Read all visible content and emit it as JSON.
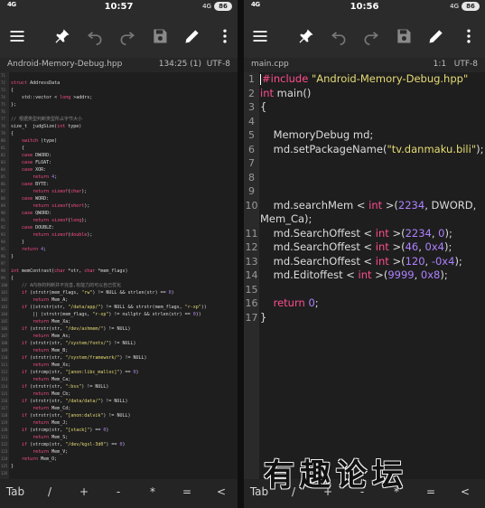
{
  "left": {
    "status": {
      "network": "4G",
      "time": "10:57",
      "battery": "86",
      "signal": "4G"
    },
    "file": {
      "name": "Android-Memory-Debug.hpp",
      "position": "134:25 (1)",
      "encoding": "UTF-8"
    },
    "lines": [
      {
        "n": "71",
        "html": ""
      },
      {
        "n": "72",
        "html": "<span class='kw'>struct</span> AddressData"
      },
      {
        "n": "73",
        "html": "{"
      },
      {
        "n": "74",
        "html": "    std::vector &lt; <span class='kw'>long</span> &gt;addrs;"
      },
      {
        "n": "75",
        "html": "};"
      },
      {
        "n": "76",
        "html": ""
      },
      {
        "n": "77",
        "html": "<span class='cm'>// 根据类型判断类型所占字节大小</span>"
      },
      {
        "n": "78",
        "html": "size_t  judgSize(<span class='kw'>int</span> type)"
      },
      {
        "n": "79",
        "html": "{"
      },
      {
        "n": "80",
        "html": "    <span class='kw'>switch</span> (type)"
      },
      {
        "n": "81",
        "html": "    {"
      },
      {
        "n": "82",
        "html": "    <span class='kw'>case</span> DWORD:"
      },
      {
        "n": "83",
        "html": "    <span class='kw'>case</span> FLOAT:"
      },
      {
        "n": "84",
        "html": "    <span class='kw'>case</span> XOR:"
      },
      {
        "n": "85",
        "html": "        <span class='kw'>return</span> <span class='num'>4</span>;"
      },
      {
        "n": "86",
        "html": "    <span class='kw'>case</span> BYTE:"
      },
      {
        "n": "87",
        "html": "        <span class='kw'>return</span> <span class='kw'>sizeof</span>(<span class='kw'>char</span>);"
      },
      {
        "n": "88",
        "html": "    <span class='kw'>case</span> WORD:"
      },
      {
        "n": "89",
        "html": "        <span class='kw'>return</span> <span class='kw'>sizeof</span>(<span class='kw'>short</span>);"
      },
      {
        "n": "90",
        "html": "    <span class='kw'>case</span> QWORD:"
      },
      {
        "n": "91",
        "html": "        <span class='kw'>return</span> <span class='kw'>sizeof</span>(<span class='kw'>long</span>);"
      },
      {
        "n": "92",
        "html": "    <span class='kw'>case</span> DOUBLE:"
      },
      {
        "n": "93",
        "html": "        <span class='kw'>return</span> <span class='kw'>sizeof</span>(<span class='kw'>double</span>);"
      },
      {
        "n": "94",
        "html": "    }"
      },
      {
        "n": "95",
        "html": "    <span class='kw'>return</span> <span class='num'>4</span>;"
      },
      {
        "n": "96",
        "html": "}"
      },
      {
        "n": "97",
        "html": ""
      },
      {
        "n": "98",
        "html": "<span class='kw'>int</span> memContrast(<span class='kw'>char</span> *str, <span class='kw'>char</span> *mem_flags)"
      },
      {
        "n": "99",
        "html": "{"
      },
      {
        "n": "100",
        "html": "    <span class='cm'>// A内存的判断并不完善,有能力的可以自己优化</span>"
      },
      {
        "n": "101",
        "html": "    <span class='kw'>if</span> (strstr(mem_flags, <span class='str'>\"rw\"</span>) != NULL &amp;&amp; strlen(str) == <span class='num'>0</span>)"
      },
      {
        "n": "102",
        "html": "        <span class='kw'>return</span> Mem_A;"
      },
      {
        "n": "103",
        "html": "    <span class='kw'>if</span> ((strstr(str, <span class='str'>\"/data/app/\"</span>) != NULL &amp;&amp; strstr(mem_flags, <span class='str'>\"r-xp\"</span>))"
      },
      {
        "n": "104",
        "html": "        || (strstr(mem_flags, <span class='str'>\"r-xp\"</span>) != nullptr &amp;&amp; strlen(str) == <span class='num'>0</span>))"
      },
      {
        "n": "105",
        "html": "        <span class='kw'>return</span> Mem_Xa;"
      },
      {
        "n": "106",
        "html": "    <span class='kw'>if</span> (strstr(str, <span class='str'>\"/dev/ashmem/\"</span>) != NULL)"
      },
      {
        "n": "107",
        "html": "        <span class='kw'>return</span> Mem_As;"
      },
      {
        "n": "108",
        "html": "    <span class='kw'>if</span> (strstr(str, <span class='str'>\"/system/fonts/\"</span>) != NULL)"
      },
      {
        "n": "109",
        "html": "        <span class='kw'>return</span> Mem_B;"
      },
      {
        "n": "110",
        "html": "    <span class='kw'>if</span> (strstr(str, <span class='str'>\"/system/framework/\"</span>) != NULL)"
      },
      {
        "n": "111",
        "html": "        <span class='kw'>return</span> Mem_Xs;"
      },
      {
        "n": "112",
        "html": "    <span class='kw'>if</span> (strcmp(str, <span class='str'>\"[anon:libc_malloc]\"</span>) == <span class='num'>0</span>)"
      },
      {
        "n": "113",
        "html": "        <span class='kw'>return</span> Mem_Ca;"
      },
      {
        "n": "114",
        "html": "    <span class='kw'>if</span> (strstr(str, <span class='str'>\":bss\"</span>) != NULL)"
      },
      {
        "n": "115",
        "html": "        <span class='kw'>return</span> Mem_Cb;"
      },
      {
        "n": "116",
        "html": "    <span class='kw'>if</span> (strstr(str, <span class='str'>\"/data/data/\"</span>) != NULL)"
      },
      {
        "n": "117",
        "html": "        <span class='kw'>return</span> Mem_Cd;"
      },
      {
        "n": "118",
        "html": "    <span class='kw'>if</span> (strstr(str, <span class='str'>\"[anon:dalvik\"</span>) != NULL)"
      },
      {
        "n": "119",
        "html": "        <span class='kw'>return</span> Mem_J;"
      },
      {
        "n": "120",
        "html": "    <span class='kw'>if</span> (strcmp(str, <span class='str'>\"[stack]\"</span>) == <span class='num'>0</span>)"
      },
      {
        "n": "121",
        "html": "        <span class='kw'>return</span> Mem_S;"
      },
      {
        "n": "122",
        "html": "    <span class='kw'>if</span> (strcmp(str, <span class='str'>\"/dev/kgsl-3d0\"</span>) == <span class='num'>0</span>)"
      },
      {
        "n": "123",
        "html": "        <span class='kw'>return</span> Mem_V;"
      },
      {
        "n": "124",
        "html": "    <span class='kw'>return</span> Mem_O;"
      },
      {
        "n": "125",
        "html": "}"
      },
      {
        "n": "126",
        "html": ""
      }
    ],
    "keys": [
      "Tab",
      "/",
      "+",
      "-",
      "*",
      "=",
      "<"
    ]
  },
  "right": {
    "status": {
      "network": "4G",
      "time": "10:56",
      "battery": "86",
      "signal": "4G"
    },
    "file": {
      "name": "main.cpp",
      "position": "1:1",
      "encoding": "UTF-8"
    },
    "lines": [
      {
        "n": "1",
        "html": "<span class='cursor'></span><span class='pp'>#include</span> <span class='str'>\"Android-Memory-Debug.hpp\"</span>"
      },
      {
        "n": "2",
        "html": "<span class='kw'>int</span> main()"
      },
      {
        "n": "3",
        "html": "{"
      },
      {
        "n": "4",
        "html": ""
      },
      {
        "n": "5",
        "html": "    MemoryDebug md;"
      },
      {
        "n": "6",
        "html": "    md.setPackageName(<span class='str'>\"tv.danmaku.bili\"</span>);"
      },
      {
        "n": "7",
        "html": ""
      },
      {
        "n": "8",
        "html": ""
      },
      {
        "n": "9",
        "html": ""
      },
      {
        "n": "10",
        "html": "    md.searchMem &lt; <span class='kw'>int</span> &gt;(<span class='num'>2234</span>, DWORD,"
      },
      {
        "n": "",
        "html": "Mem_Ca);"
      },
      {
        "n": "11",
        "html": "    md.SearchOffest &lt; <span class='kw'>int</span> &gt;(<span class='num'>2234</span>, <span class='num'>0</span>);"
      },
      {
        "n": "12",
        "html": "    md.SearchOffest &lt; <span class='kw'>int</span> &gt;(<span class='num'>46</span>, <span class='num'>0x4</span>);"
      },
      {
        "n": "13",
        "html": "    md.SearchOffest &lt; <span class='kw'>int</span> &gt;(<span class='num'>120</span>, <span class='num'>-0x4</span>);"
      },
      {
        "n": "14",
        "html": "    md.Editoffest &lt; <span class='kw'>int</span> &gt;(<span class='num'>9999</span>, <span class='num'>0x8</span>);"
      },
      {
        "n": "15",
        "html": ""
      },
      {
        "n": "16",
        "html": "    <span class='kw'>return</span> <span class='num'>0</span>;"
      },
      {
        "n": "17",
        "html": "}"
      }
    ],
    "keys": [
      "Tab",
      "/",
      "+",
      "-",
      "*",
      "=",
      "<"
    ]
  },
  "watermark": "有趣论坛",
  "icons": [
    "menu-icon",
    "pin-icon",
    "undo-icon",
    "redo-icon",
    "save-icon",
    "edit-pencil-icon",
    "more-vertical-icon"
  ]
}
